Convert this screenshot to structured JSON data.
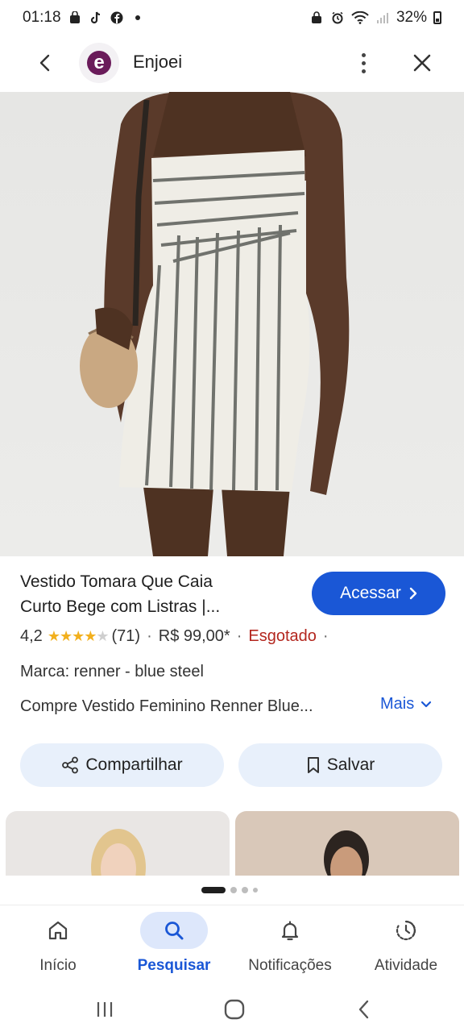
{
  "status_bar": {
    "time": "01:18",
    "battery": "32%"
  },
  "app_bar": {
    "site_name": "Enjoei",
    "logo_letter": "e"
  },
  "product": {
    "title_line1": "Vestido Tomara Que Caia",
    "title_line2": "Curto Bege com Listras |...",
    "cta_label": "Acessar",
    "rating": "4,2",
    "stars_filled": 4,
    "stars_total": 5,
    "review_count": "(71)",
    "price": "R$ 99,00*",
    "availability": "Esgotado",
    "brand": "Marca: renner - blue steel",
    "description": "Compre Vestido Feminino Renner Blue...",
    "more_label": "Mais"
  },
  "actions": {
    "share_label": "Compartilhar",
    "save_label": "Salvar"
  },
  "carousel": {
    "pages": 4,
    "active_index": 0
  },
  "bottom_nav": {
    "items": [
      {
        "label": "Início",
        "icon": "home-icon",
        "active": false
      },
      {
        "label": "Pesquisar",
        "icon": "search-icon",
        "active": true
      },
      {
        "label": "Notificações",
        "icon": "bell-icon",
        "active": false
      },
      {
        "label": "Atividade",
        "icon": "activity-icon",
        "active": false
      }
    ]
  },
  "colors": {
    "accent": "#1a57d6",
    "soldout": "#b3261e",
    "star": "#f2b01e",
    "pill_bg": "#e8f0fb",
    "brand": "#6a1b5a"
  }
}
